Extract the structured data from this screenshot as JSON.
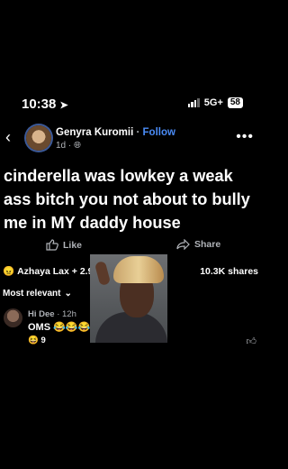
{
  "status_bar": {
    "time": "10:38",
    "network": "5G+",
    "battery": "58"
  },
  "post": {
    "author": "Genyra Kuromii",
    "separator": "·",
    "follow_label": "Follow",
    "age": "1d ·",
    "text": "cinderella was lowkey a weak ass bitch you not about to bully me in MY daddy house",
    "like_label": "Like",
    "share_label": "Share",
    "reaction_summary": "Azhaya Lax + 2.9",
    "share_count": "10.3K shares"
  },
  "comments": {
    "sort_label": "Most relevant",
    "items": [
      {
        "author": "Hi Dee",
        "time": "· 12h",
        "text": "OMS",
        "reaction_count": "9"
      }
    ]
  },
  "icons": {
    "back": "chevron-left-icon",
    "more": "more-horizontal-icon",
    "like": "thumbs-up-icon",
    "share": "share-arrow-icon",
    "globe": "globe-icon"
  },
  "colors": {
    "accent": "#4a8bf5",
    "muted": "#b0b3b8",
    "background": "#000000"
  }
}
